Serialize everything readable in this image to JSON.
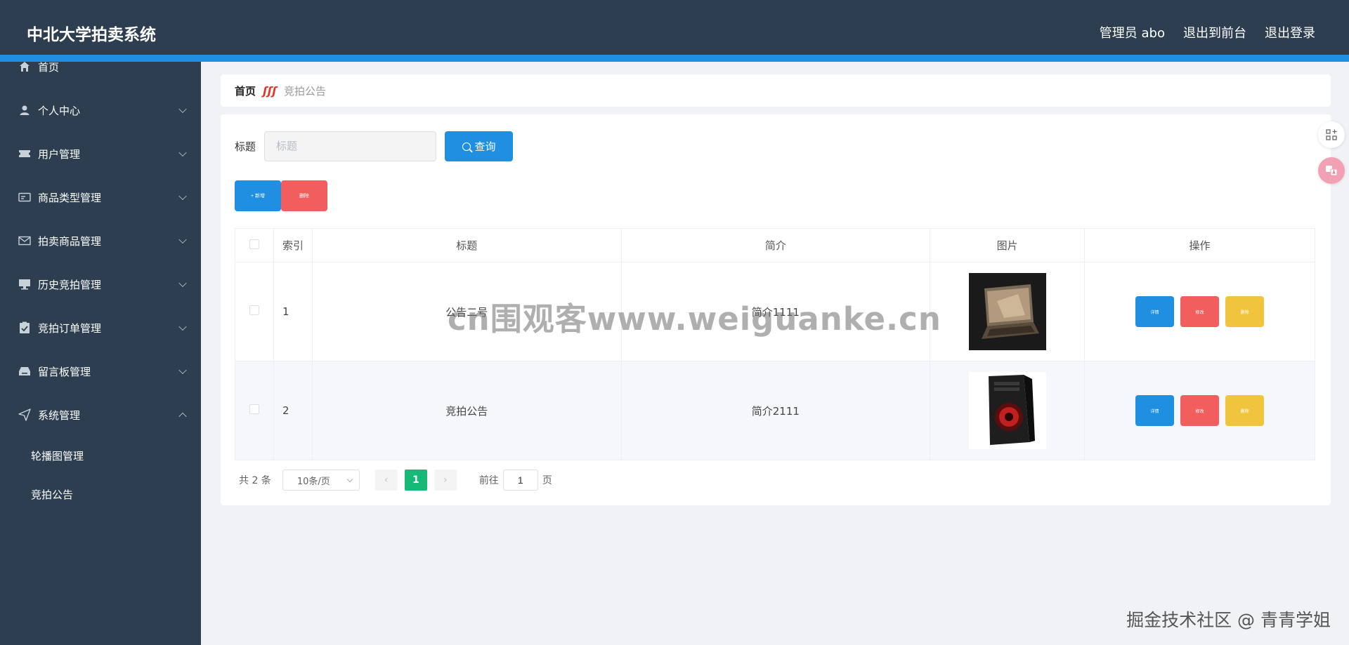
{
  "header": {
    "brand": "中北大学拍卖系统",
    "links": [
      "管理员 abo",
      "退出到前台",
      "退出登录"
    ]
  },
  "sidebar": {
    "items": [
      {
        "label": "首页",
        "icon": "home-icon",
        "expandable": false
      },
      {
        "label": "个人中心",
        "icon": "user-icon",
        "expandable": true
      },
      {
        "label": "用户管理",
        "icon": "ticket-icon",
        "expandable": true
      },
      {
        "label": "商品类型管理",
        "icon": "card-icon",
        "expandable": true
      },
      {
        "label": "拍卖商品管理",
        "icon": "mail-icon",
        "expandable": true
      },
      {
        "label": "历史竞拍管理",
        "icon": "monitor-icon",
        "expandable": true
      },
      {
        "label": "竞拍订单管理",
        "icon": "clipboard-check-icon",
        "expandable": true
      },
      {
        "label": "留言板管理",
        "icon": "inbox-icon",
        "expandable": true
      },
      {
        "label": "系统管理",
        "icon": "send-icon",
        "expandable": true,
        "expanded": true
      }
    ],
    "sub_items": [
      "轮播图管理",
      "竞拍公告"
    ]
  },
  "breadcrumb": {
    "home": "首页",
    "current": "竞拍公告"
  },
  "search": {
    "label": "标题",
    "placeholder": "标题",
    "button": "查询"
  },
  "actions": {
    "add": "+ 新增",
    "delete": "删除"
  },
  "table": {
    "headers": [
      "索引",
      "标题",
      "简介",
      "图片",
      "操作"
    ],
    "rows": [
      {
        "index": "1",
        "title": "公告二号",
        "intro": "简介1111",
        "image": "laptop"
      },
      {
        "index": "2",
        "title": "竞拍公告",
        "intro": "简介2111",
        "image": "pc-tower"
      }
    ],
    "op_labels": {
      "detail": "详情",
      "edit": "修改",
      "delete": "删除"
    }
  },
  "pagination": {
    "total": "共 2 条",
    "page_size": "10条/页",
    "current_page": "1",
    "goto_label": "前往",
    "goto_value": "1",
    "page_suffix": "页"
  },
  "watermarks": {
    "center": "cn围观客www.weiguanke.cn",
    "corner": "掘金技术社区 @ 青青学姐"
  },
  "colors": {
    "header_bg": "#2c3e50",
    "accent": "#1e8fe1",
    "danger": "#f25d5d",
    "warning": "#f0c43c",
    "page_active": "#17b978"
  }
}
